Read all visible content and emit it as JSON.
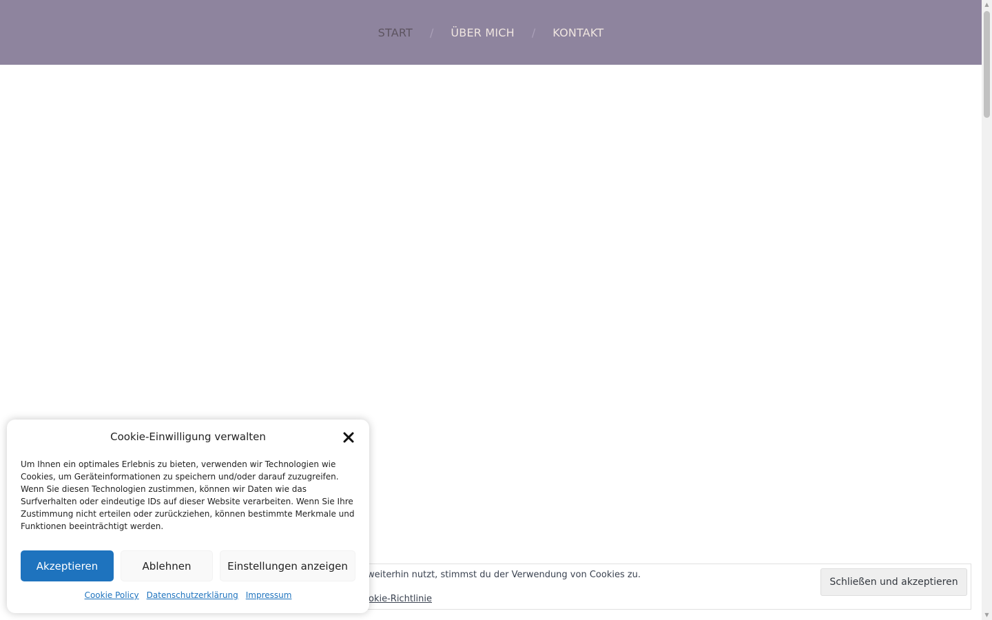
{
  "nav": {
    "items": [
      {
        "label": "START"
      },
      {
        "label": "ÜBER MICH"
      },
      {
        "label": "KONTAKT"
      }
    ],
    "separator": "/"
  },
  "cookie_bar": {
    "text": "weiterhin nutzt, stimmst du der Verwendung von Cookies zu.",
    "link_label": "okie-Richtlinie",
    "button_label": "Schließen und akzeptieren"
  },
  "consent": {
    "title": "Cookie-Einwilligung verwalten",
    "body": "Um Ihnen ein optimales Erlebnis zu bieten, verwenden wir Technologien wie Cookies, um Geräteinformationen zu speichern und/oder darauf zuzugreifen. Wenn Sie diesen Technologien zustimmen, können wir Daten wie das Surfverhalten oder eindeutige IDs auf dieser Website verarbeiten. Wenn Sie Ihre Zustimmung nicht erteilen oder zurückziehen, können bestimmte Merkmale und Funktionen beeinträchtigt werden.",
    "accept_label": "Akzeptieren",
    "deny_label": "Ablehnen",
    "prefs_label": "Einstellungen anzeigen",
    "links": {
      "cookie_policy": "Cookie Policy",
      "privacy": "Datenschutzerklärung",
      "imprint": "Impressum"
    },
    "close_icon": "close-icon"
  },
  "colors": {
    "header_bg": "#8e849e",
    "nav_text": "#efe5e0",
    "nav_current": "#5d5460",
    "accent_blue": "#1e73be"
  }
}
